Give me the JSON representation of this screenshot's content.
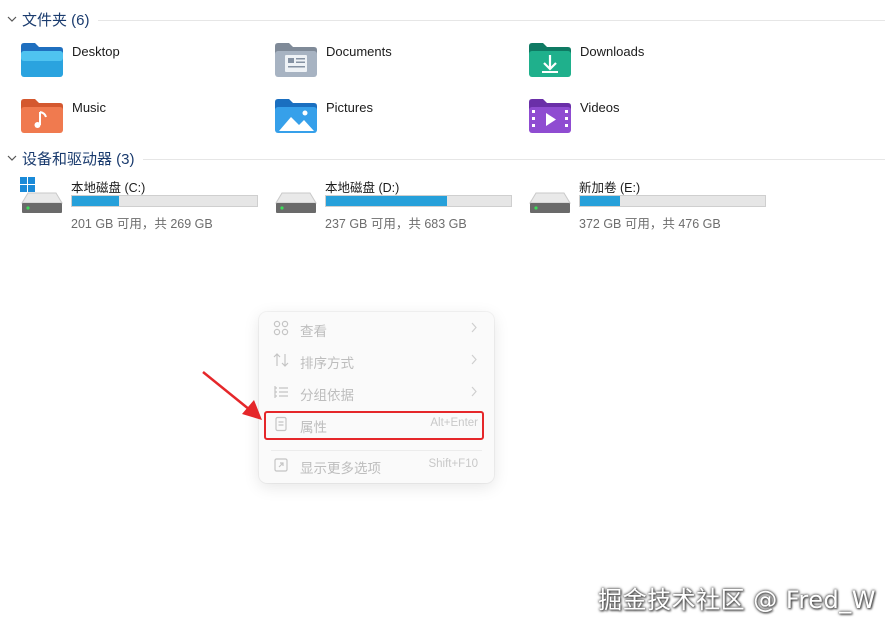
{
  "folders_section": {
    "title": "文件夹 (6)"
  },
  "folders": [
    {
      "name": "Desktop",
      "icon": "desktop-folder-icon"
    },
    {
      "name": "Documents",
      "icon": "documents-folder-icon"
    },
    {
      "name": "Downloads",
      "icon": "downloads-folder-icon"
    },
    {
      "name": "Music",
      "icon": "music-folder-icon"
    },
    {
      "name": "Pictures",
      "icon": "pictures-folder-icon"
    },
    {
      "name": "Videos",
      "icon": "videos-folder-icon"
    }
  ],
  "drives_section": {
    "title": "设备和驱动器 (3)"
  },
  "drives": [
    {
      "name": "本地磁盘 (C:)",
      "space": "201 GB 可用，共 269 GB",
      "used_fraction": 0.253
    },
    {
      "name": "本地磁盘 (D:)",
      "space": "237 GB 可用，共 683 GB",
      "used_fraction": 0.653
    },
    {
      "name": "新加卷 (E:)",
      "space": "372 GB 可用，共 476 GB",
      "used_fraction": 0.218
    }
  ],
  "context_menu": {
    "items": [
      {
        "label": "查看",
        "icon": "view-grid-icon",
        "has_submenu": true
      },
      {
        "label": "排序方式",
        "icon": "sort-icon",
        "has_submenu": true
      },
      {
        "label": "分组依据",
        "icon": "group-by-icon",
        "has_submenu": true
      },
      {
        "label": "属性",
        "icon": "properties-icon",
        "shortcut": "Alt+Enter"
      },
      {
        "label": "显示更多选项",
        "icon": "more-options-icon",
        "shortcut": "Shift+F10"
      }
    ]
  },
  "colors": {
    "accent": "#26a0da",
    "section_title": "#1a3b6e",
    "annotation": "#e5272a"
  },
  "watermark": "掘金技术社区 @ Fred_W"
}
